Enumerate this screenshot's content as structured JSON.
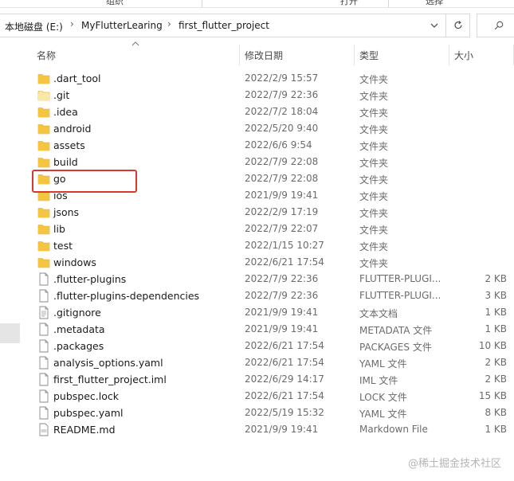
{
  "ribbon": {
    "items": [
      "组织",
      "打开",
      "选择"
    ]
  },
  "address_bar": {
    "crumbs": [
      "本地磁盘 (E:)",
      "MyFlutterLearing",
      "first_flutter_project"
    ]
  },
  "columns": {
    "name": "名称",
    "modified": "修改日期",
    "type": "类型",
    "size": "大小"
  },
  "files": [
    {
      "name": ".dart_tool",
      "modified": "2022/2/9 15:57",
      "type": "文件夹",
      "size": "",
      "kind": "folder"
    },
    {
      "name": ".git",
      "modified": "2022/7/9 22:36",
      "type": "文件夹",
      "size": "",
      "kind": "folder-faded"
    },
    {
      "name": ".idea",
      "modified": "2022/7/2 18:04",
      "type": "文件夹",
      "size": "",
      "kind": "folder"
    },
    {
      "name": "android",
      "modified": "2022/5/20 9:40",
      "type": "文件夹",
      "size": "",
      "kind": "folder"
    },
    {
      "name": "assets",
      "modified": "2022/6/6 9:54",
      "type": "文件夹",
      "size": "",
      "kind": "folder"
    },
    {
      "name": "build",
      "modified": "2022/7/9 22:08",
      "type": "文件夹",
      "size": "",
      "kind": "folder"
    },
    {
      "name": "go",
      "modified": "2022/7/9 22:08",
      "type": "文件夹",
      "size": "",
      "kind": "folder"
    },
    {
      "name": "ios",
      "modified": "2021/9/9 19:41",
      "type": "文件夹",
      "size": "",
      "kind": "folder"
    },
    {
      "name": "jsons",
      "modified": "2022/2/9 17:19",
      "type": "文件夹",
      "size": "",
      "kind": "folder"
    },
    {
      "name": "lib",
      "modified": "2022/7/9 22:07",
      "type": "文件夹",
      "size": "",
      "kind": "folder"
    },
    {
      "name": "test",
      "modified": "2022/1/15 10:27",
      "type": "文件夹",
      "size": "",
      "kind": "folder"
    },
    {
      "name": "windows",
      "modified": "2022/6/21 17:54",
      "type": "文件夹",
      "size": "",
      "kind": "folder"
    },
    {
      "name": ".flutter-plugins",
      "modified": "2022/7/9 22:36",
      "type": "FLUTTER-PLUGI...",
      "size": "2 KB",
      "kind": "file"
    },
    {
      "name": ".flutter-plugins-dependencies",
      "modified": "2022/7/9 22:36",
      "type": "FLUTTER-PLUGI...",
      "size": "3 KB",
      "kind": "file"
    },
    {
      "name": ".gitignore",
      "modified": "2021/9/9 19:41",
      "type": "文本文档",
      "size": "1 KB",
      "kind": "text"
    },
    {
      "name": ".metadata",
      "modified": "2021/9/9 19:41",
      "type": "METADATA 文件",
      "size": "1 KB",
      "kind": "file"
    },
    {
      "name": ".packages",
      "modified": "2022/6/21 17:54",
      "type": "PACKAGES 文件",
      "size": "10 KB",
      "kind": "file"
    },
    {
      "name": "analysis_options.yaml",
      "modified": "2022/6/21 17:54",
      "type": "YAML 文件",
      "size": "2 KB",
      "kind": "file"
    },
    {
      "name": "first_flutter_project.iml",
      "modified": "2022/6/29 14:17",
      "type": "IML 文件",
      "size": "2 KB",
      "kind": "file"
    },
    {
      "name": "pubspec.lock",
      "modified": "2022/6/21 17:54",
      "type": "LOCK 文件",
      "size": "15 KB",
      "kind": "file"
    },
    {
      "name": "pubspec.yaml",
      "modified": "2022/5/19 15:32",
      "type": "YAML 文件",
      "size": "8 KB",
      "kind": "file"
    },
    {
      "name": "README.md",
      "modified": "2021/9/9 19:41",
      "type": "Markdown File",
      "size": "1 KB",
      "kind": "markdown"
    }
  ],
  "colors": {
    "folder": "#f5c542",
    "folder_faded": "#fbe7a6",
    "highlight": "#d63a2f"
  },
  "watermark": "@稀土掘金技术社区"
}
